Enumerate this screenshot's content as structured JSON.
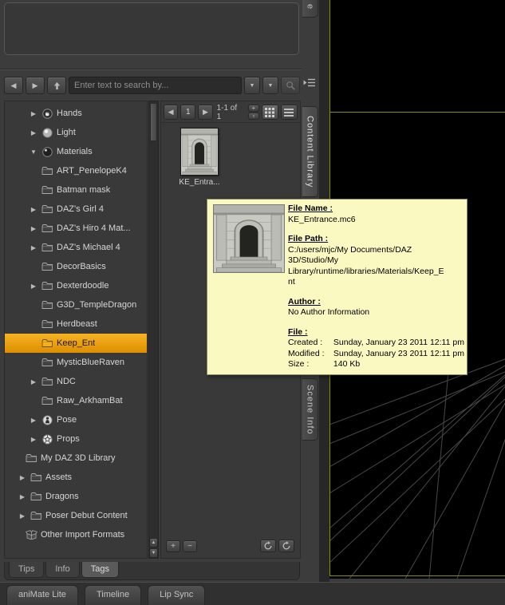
{
  "colors": {
    "accent_selected": "#e8a200",
    "tooltip_bg": "#fbf9c2",
    "viewport_frame": "#8d8d00"
  },
  "search": {
    "placeholder": "Enter text to search by..."
  },
  "icons": {
    "back": "◀",
    "forward": "▶",
    "dropdown": "▼",
    "scroll_up": "▲",
    "scroll_down": "▼",
    "expand": "▶",
    "collapse": "▼",
    "size_up": "+",
    "size_down": "▫"
  },
  "vertical_tabs": {
    "partial_top": "e",
    "content_library": "Content Library",
    "scene_info": "Scene Info"
  },
  "content_header": {
    "page_number": "1",
    "range_label": "1-1 of 1"
  },
  "content": {
    "items": [
      {
        "label": "KE_Entra..."
      }
    ]
  },
  "buttons": {
    "add": "+",
    "remove": "−"
  },
  "tree": {
    "items": [
      {
        "label": "Hands",
        "icon": "hands",
        "arrow": "right",
        "indent": 2
      },
      {
        "label": "Light",
        "icon": "light",
        "arrow": "right",
        "indent": 2
      },
      {
        "label": "Materials",
        "icon": "materials",
        "arrow": "down",
        "indent": 2
      },
      {
        "label": "ART_PenelopeK4",
        "icon": "folder",
        "arrow": "none",
        "indent": 2
      },
      {
        "label": "Batman mask",
        "icon": "folder",
        "arrow": "none",
        "indent": 2
      },
      {
        "label": "DAZ's Girl 4",
        "icon": "folder",
        "arrow": "right",
        "indent": 2
      },
      {
        "label": "DAZ's Hiro 4 Mat...",
        "icon": "folder",
        "arrow": "right",
        "indent": 2
      },
      {
        "label": "DAZ's Michael 4",
        "icon": "folder",
        "arrow": "right",
        "indent": 2
      },
      {
        "label": "DecorBasics",
        "icon": "folder",
        "arrow": "none",
        "indent": 2
      },
      {
        "label": "Dexterdoodle",
        "icon": "folder",
        "arrow": "right",
        "indent": 2
      },
      {
        "label": "G3D_TempleDragon",
        "icon": "folder",
        "arrow": "none",
        "indent": 2
      },
      {
        "label": "Herdbeast",
        "icon": "folder",
        "arrow": "none",
        "indent": 2
      },
      {
        "label": "Keep_Ent",
        "icon": "folder",
        "arrow": "none",
        "indent": 2,
        "selected": true
      },
      {
        "label": "MysticBlueRaven",
        "icon": "folder",
        "arrow": "none",
        "indent": 2
      },
      {
        "label": "NDC",
        "icon": "folder",
        "arrow": "right",
        "indent": 2
      },
      {
        "label": "Raw_ArkhamBat",
        "icon": "folder",
        "arrow": "none",
        "indent": 2
      },
      {
        "label": "Pose",
        "icon": "pose",
        "arrow": "right",
        "indent": 2
      },
      {
        "label": "Props",
        "icon": "props",
        "arrow": "right",
        "indent": 2
      },
      {
        "label": "My DAZ 3D Library",
        "icon": "folder",
        "arrow": "none",
        "indent": 0
      },
      {
        "label": "Assets",
        "icon": "folder",
        "arrow": "right",
        "indent": 1
      },
      {
        "label": "Dragons",
        "icon": "folder",
        "arrow": "right",
        "indent": 1
      },
      {
        "label": "Poser Debut Content",
        "icon": "folder",
        "arrow": "right",
        "indent": 1
      },
      {
        "label": "Other Import Formats",
        "icon": "box",
        "arrow": "none",
        "indent": 0
      }
    ]
  },
  "tooltip": {
    "file_name_heading": "File Name :",
    "file_name": "KE_Entrance.mc6",
    "file_path_heading": "File Path :",
    "file_path": "C:/users/mjc/My Documents/DAZ 3D/Studio/My Library/runtime/libraries/Materials/Keep_Ent",
    "author_heading": "Author :",
    "author": "No Author Information",
    "file_heading": "File :",
    "created_label": "Created :",
    "created_value": "Sunday, January 23 2011 12:11 pm",
    "modified_label": "Modified :",
    "modified_value": "Sunday, January 23 2011 12:11 pm",
    "size_label": "Size :",
    "size_value": "140 Kb"
  },
  "bottom_tabs": {
    "tips": "Tips",
    "info": "Info",
    "tags": "Tags"
  },
  "app_tabs": {
    "animate": "aniMate Lite",
    "timeline": "Timeline",
    "lipsync": "Lip Sync"
  }
}
